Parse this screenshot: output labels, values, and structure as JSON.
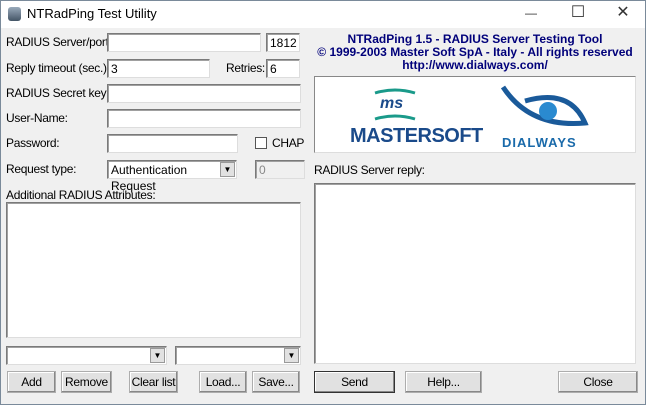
{
  "window": {
    "title": "NTRadPing Test Utility",
    "minimize": "—",
    "maximize": "☐",
    "close": "✕"
  },
  "form": {
    "server_label": "RADIUS Server/port:",
    "server_value": "",
    "port_value": "1812",
    "timeout_label": "Reply timeout (sec.):",
    "timeout_value": "3",
    "retries_label": "Retries:",
    "retries_value": "6",
    "secret_label": "RADIUS Secret key:",
    "secret_value": "",
    "username_label": "User-Name:",
    "username_value": "",
    "password_label": "Password:",
    "password_value": "",
    "chap_label": "CHAP",
    "chap_checked": false,
    "request_type_label": "Request type:",
    "request_type_value": "Authentication Request",
    "request_id_value": "0",
    "attributes_label": "Additional RADIUS Attributes:"
  },
  "buttons": {
    "add": "Add",
    "remove": "Remove",
    "clear": "Clear list",
    "load": "Load...",
    "save": "Save...",
    "send": "Send",
    "help": "Help...",
    "close": "Close"
  },
  "header": {
    "line1": "NTRadPing 1.5 - RADIUS Server Testing Tool",
    "line2": "© 1999-2003 Master Soft SpA - Italy - All rights reserved",
    "line3": "http://www.dialways.com/"
  },
  "logos": {
    "mastersoft_ms": "ms",
    "mastersoft_text": "MASTERSOFT",
    "dialways_text": "DIALWAYS"
  },
  "reply": {
    "label": "RADIUS Server reply:",
    "value": ""
  },
  "colors": {
    "header_text": "#00007a",
    "mastersoft_blue": "#1a4a8a",
    "teal": "#1a9a8a",
    "dialways_blue": "#1a6aaa"
  }
}
